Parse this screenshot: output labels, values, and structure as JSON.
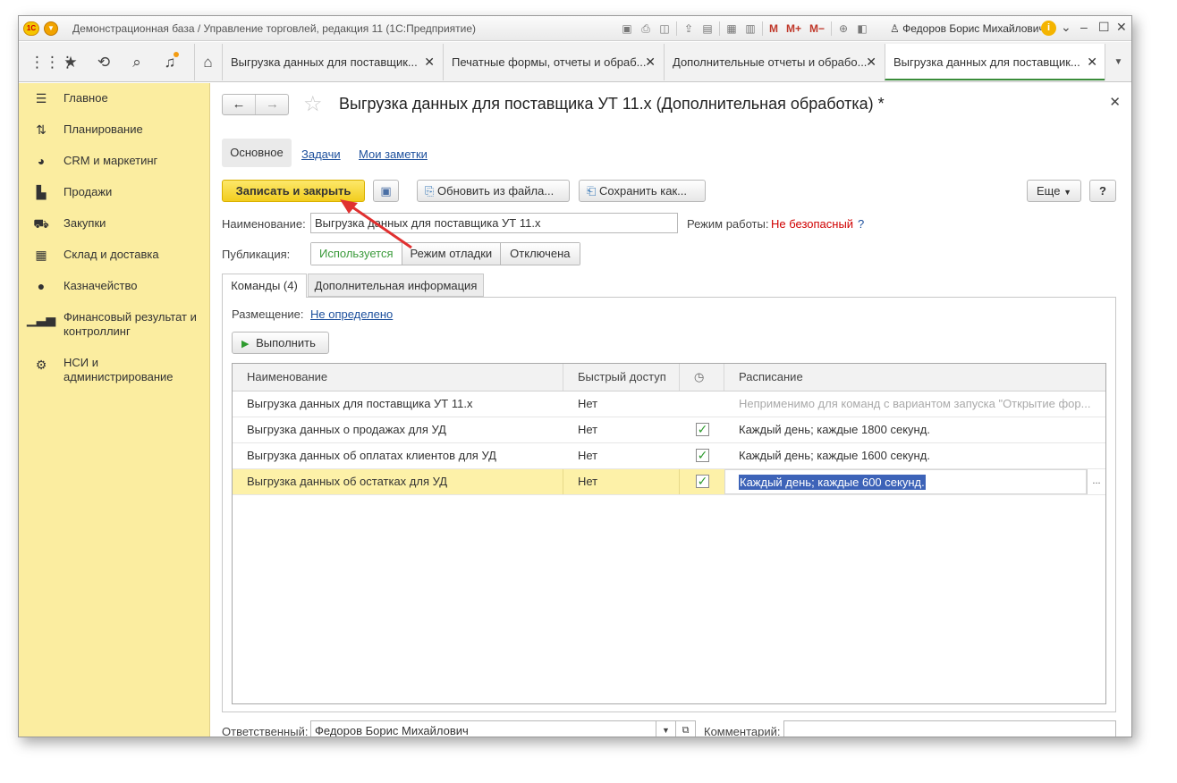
{
  "titlebar": {
    "app_title": "Демонстрационная база / Управление торговлей, редакция 11  (1С:Предприятие)",
    "logo_text": "1С",
    "tool_m": "M",
    "tool_mplus": "M+",
    "tool_mminus": "M−",
    "user": "Федоров Борис Михайлович",
    "info": "i"
  },
  "tabs": [
    {
      "label": "Выгрузка данных для поставщик..."
    },
    {
      "label": "Печатные формы, отчеты и обраб..."
    },
    {
      "label": "Дополнительные отчеты и обрабо..."
    },
    {
      "label": "Выгрузка данных для поставщик..."
    }
  ],
  "sidebar": {
    "items": [
      {
        "label": "Главное",
        "icon": "menu-icon"
      },
      {
        "label": "Планирование",
        "icon": "planning-icon"
      },
      {
        "label": "CRM и маркетинг",
        "icon": "pie-chart-icon"
      },
      {
        "label": "Продажи",
        "icon": "bag-icon"
      },
      {
        "label": "Закупки",
        "icon": "cart-icon"
      },
      {
        "label": "Склад и доставка",
        "icon": "warehouse-icon"
      },
      {
        "label": "Казначейство",
        "icon": "money-icon"
      },
      {
        "label": "Финансовый результат и контроллинг",
        "icon": "bar-chart-icon"
      },
      {
        "label": "НСИ и администрирование",
        "icon": "gear-icon"
      }
    ]
  },
  "form": {
    "title": "Выгрузка данных для поставщика УТ 11.x (Дополнительная обработка) *",
    "subtabs": {
      "main": "Основное",
      "tasks": "Задачи",
      "notes": "Мои заметки"
    },
    "toolbar": {
      "save_close": "Записать и закрыть",
      "update_from_file": "Обновить из файла...",
      "save_as": "Сохранить как...",
      "more": "Еще",
      "help": "?"
    },
    "name_label": "Наименование:",
    "name_value": "Выгрузка данных для поставщика УТ 11.x",
    "mode_label": "Режим работы:",
    "mode_value": "Не безопасный",
    "mode_help": "?",
    "publication_label": "Публикация:",
    "publication_options": [
      "Используется",
      "Режим отладки",
      "Отключена"
    ],
    "publication_selected": "Используется",
    "inner_tabs": [
      "Команды (4)",
      "Дополнительная информация"
    ],
    "placement_label": "Размещение:",
    "placement_value": "Не определено",
    "execute_button": "Выполнить",
    "table": {
      "columns": [
        "Наименование",
        "Быстрый доступ",
        "",
        "Расписание"
      ],
      "rows": [
        {
          "name": "Выгрузка данных для поставщика УТ 11.x",
          "quick": "Нет",
          "checked": false,
          "schedule": "Неприменимо для команд с вариантом запуска \"Открытие фор..."
        },
        {
          "name": "Выгрузка данных о продажах для УД",
          "quick": "Нет",
          "checked": true,
          "schedule": "Каждый день; каждые 1800 секунд."
        },
        {
          "name": "Выгрузка данных об оплатах клиентов для УД",
          "quick": "Нет",
          "checked": true,
          "schedule": "Каждый день; каждые 1600 секунд."
        },
        {
          "name": "Выгрузка данных об остатках для УД",
          "quick": "Нет",
          "checked": true,
          "schedule": "Каждый день; каждые 600 секунд."
        }
      ],
      "selected_row": 3,
      "cell_button": "..."
    },
    "responsible_label": "Ответственный:",
    "responsible_value": "Федоров Борис Михайлович",
    "comment_label": "Комментарий:",
    "comment_value": ""
  },
  "colors": {
    "sidebar_bg": "#fbeda0",
    "primary_button": "#f5d325",
    "mode_unsafe": "#d00000",
    "used_green": "#3a9a3a",
    "link": "#1c4f9c",
    "selection": "#3d63b8",
    "arrow": "#e03030"
  }
}
